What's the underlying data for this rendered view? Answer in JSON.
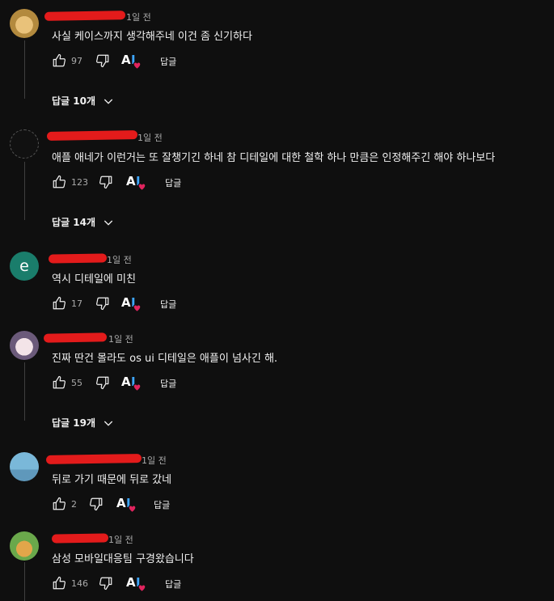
{
  "comments": [
    {
      "time": "1일 전",
      "text": "사실 케이스까지 생각해주네 이건 좀 신기하다",
      "likes": "97",
      "reply_label": "답글",
      "replies": "답글 10개"
    },
    {
      "time": "1일 전",
      "text": "애플 애네가 이런거는 또 잘챙기긴 하네 참 디테일에 대한 철학 하나 만큼은 인정해주긴 해야 하나보다",
      "likes": "123",
      "reply_label": "답글",
      "replies": "답글 14개"
    },
    {
      "avatar_letter": "e",
      "time": "1일 전",
      "text": "역시 디테일에 미친",
      "likes": "17",
      "reply_label": "답글"
    },
    {
      "time": "1일 전",
      "text": "진짜 딴건 몰라도 os ui 디테일은 애플이 넘사긴 해.",
      "likes": "55",
      "reply_label": "답글",
      "replies": "답글 19개"
    },
    {
      "time": "1일 전",
      "text": "뒤로 가기 때문에 뒤로 갔네",
      "likes": "2",
      "reply_label": "답글"
    },
    {
      "time": "1일 전",
      "text": "삼성 모바일대응팀 구경왔습니다",
      "likes": "146",
      "reply_label": "답글"
    }
  ],
  "ai_badge": {
    "a": "A",
    "i": "I"
  },
  "colors": {
    "background": "#0f0f0f",
    "redaction": "#e31b1b",
    "accent_blue": "#3ea6ff",
    "heart": "#e0245e"
  }
}
